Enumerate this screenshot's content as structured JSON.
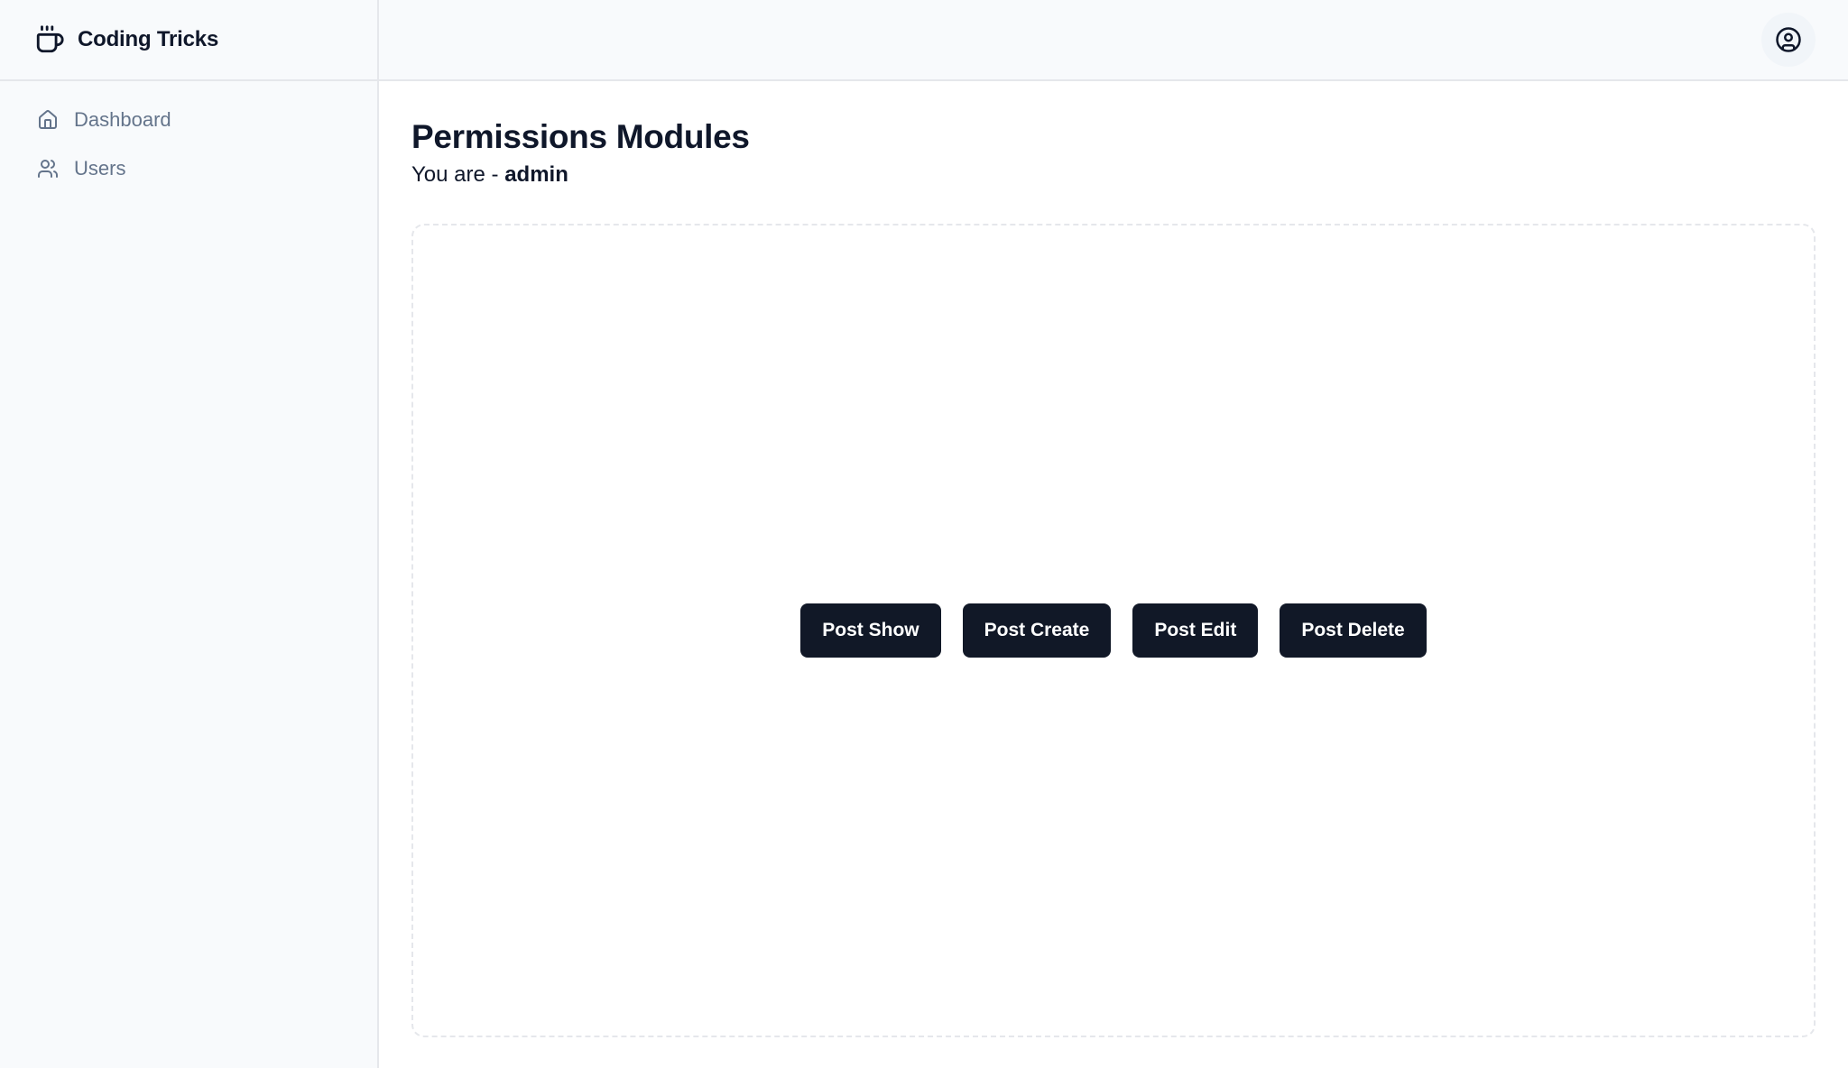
{
  "sidebar": {
    "brand": {
      "name": "Coding Tricks",
      "icon": "coffee-icon"
    },
    "items": [
      {
        "label": "Dashboard",
        "icon": "home-icon"
      },
      {
        "label": "Users",
        "icon": "users-icon"
      }
    ]
  },
  "topbar": {
    "user_icon": "user-circle-icon"
  },
  "main": {
    "title": "Permissions Modules",
    "role_prefix": "You are - ",
    "role": "admin",
    "buttons": [
      {
        "label": "Post Show"
      },
      {
        "label": "Post Create"
      },
      {
        "label": "Post Edit"
      },
      {
        "label": "Post Delete"
      }
    ]
  },
  "colors": {
    "sidebar_bg": "#f8fafc",
    "border": "#e5e7eb",
    "button_bg": "#111827",
    "nav_text": "#64748b",
    "text": "#0f172a"
  }
}
